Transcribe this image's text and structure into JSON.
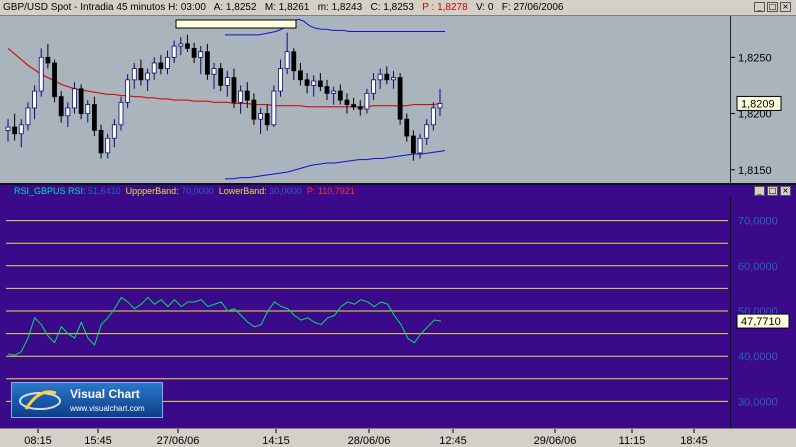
{
  "header": {
    "title": "GBP/USD Spot - Intradia 45 minutos",
    "h_label": "H:",
    "h_value": "03:00",
    "a_label": "A:",
    "a_value": "1,8252",
    "m_upper_label": "M:",
    "m_upper_value": "1,8261",
    "m_lower_label": "m:",
    "m_lower_value": "1,8243",
    "c_label": "C:",
    "c_value": "1,8253",
    "p_label": "P :",
    "p_value": "1,8278",
    "v_label": "V:",
    "v_value": "0",
    "f_label": "F:",
    "f_value": "27/06/2006"
  },
  "window_buttons": [
    "_",
    "□",
    "×"
  ],
  "rsi_header": {
    "rsi_label": "RSI_GBPUS RSI:",
    "rsi_value": "51,6410",
    "upper_label": "UppperBand:",
    "upper_value": "70,0000",
    "lower_label": "LowerBand:",
    "lower_value": "30,0000",
    "p_label": "P:",
    "p_value": "110,7921"
  },
  "logo": {
    "title": "Visual Chart",
    "url": "www.visualchart.com"
  },
  "colors": {
    "price_bg": "#a9b4bd",
    "candle_up": "#0a0a7a",
    "candle_down": "#000000",
    "moving_average": "#d01010",
    "bollinger": "#1010d0",
    "rsi_bg": "#3a0a8a",
    "rsi_line": "#00e070",
    "rsi_levels": "#e8e040"
  },
  "chart_data": [
    {
      "type": "candlestick",
      "title": "GBP/USD Spot - Intradia 45 minutos",
      "ylim": [
        1.814,
        1.8285
      ],
      "y_ticks": [
        "1,8250",
        "1,8200",
        "1,8150"
      ],
      "y_tick_values": [
        1.825,
        1.82,
        1.815
      ],
      "last_value_label": "1,8209",
      "last_value": 1.8209,
      "candles": [
        {
          "o": 1.8185,
          "h": 1.8195,
          "l": 1.8175,
          "c": 1.8188
        },
        {
          "o": 1.8188,
          "h": 1.82,
          "l": 1.8176,
          "c": 1.8182
        },
        {
          "o": 1.8182,
          "h": 1.8195,
          "l": 1.817,
          "c": 1.819
        },
        {
          "o": 1.819,
          "h": 1.821,
          "l": 1.8185,
          "c": 1.8205
        },
        {
          "o": 1.8205,
          "h": 1.8225,
          "l": 1.8195,
          "c": 1.822
        },
        {
          "o": 1.822,
          "h": 1.8258,
          "l": 1.8215,
          "c": 1.825
        },
        {
          "o": 1.825,
          "h": 1.8262,
          "l": 1.824,
          "c": 1.8245
        },
        {
          "o": 1.8245,
          "h": 1.8248,
          "l": 1.821,
          "c": 1.8215
        },
        {
          "o": 1.8215,
          "h": 1.822,
          "l": 1.8192,
          "c": 1.8198
        },
        {
          "o": 1.8198,
          "h": 1.821,
          "l": 1.8188,
          "c": 1.8205
        },
        {
          "o": 1.8205,
          "h": 1.8228,
          "l": 1.82,
          "c": 1.8222
        },
        {
          "o": 1.8222,
          "h": 1.8226,
          "l": 1.8195,
          "c": 1.82
        },
        {
          "o": 1.82,
          "h": 1.8212,
          "l": 1.8192,
          "c": 1.8208
        },
        {
          "o": 1.8208,
          "h": 1.8215,
          "l": 1.818,
          "c": 1.8185
        },
        {
          "o": 1.8185,
          "h": 1.819,
          "l": 1.816,
          "c": 1.8165
        },
        {
          "o": 1.8165,
          "h": 1.8182,
          "l": 1.816,
          "c": 1.8178
        },
        {
          "o": 1.8178,
          "h": 1.8195,
          "l": 1.817,
          "c": 1.819
        },
        {
          "o": 1.819,
          "h": 1.8215,
          "l": 1.8185,
          "c": 1.821
        },
        {
          "o": 1.821,
          "h": 1.8235,
          "l": 1.8205,
          "c": 1.823
        },
        {
          "o": 1.823,
          "h": 1.8245,
          "l": 1.8222,
          "c": 1.824
        },
        {
          "o": 1.824,
          "h": 1.8248,
          "l": 1.8225,
          "c": 1.823
        },
        {
          "o": 1.823,
          "h": 1.824,
          "l": 1.822,
          "c": 1.8236
        },
        {
          "o": 1.8236,
          "h": 1.825,
          "l": 1.823,
          "c": 1.8245
        },
        {
          "o": 1.8245,
          "h": 1.8252,
          "l": 1.8235,
          "c": 1.824
        },
        {
          "o": 1.824,
          "h": 1.8256,
          "l": 1.8235,
          "c": 1.825
        },
        {
          "o": 1.825,
          "h": 1.8265,
          "l": 1.8245,
          "c": 1.826
        },
        {
          "o": 1.826,
          "h": 1.8268,
          "l": 1.8252,
          "c": 1.8262
        },
        {
          "o": 1.8262,
          "h": 1.827,
          "l": 1.8255,
          "c": 1.8258
        },
        {
          "o": 1.8258,
          "h": 1.8263,
          "l": 1.8245,
          "c": 1.825
        },
        {
          "o": 1.825,
          "h": 1.826,
          "l": 1.8235,
          "c": 1.8255
        },
        {
          "o": 1.8255,
          "h": 1.8262,
          "l": 1.823,
          "c": 1.8235
        },
        {
          "o": 1.8235,
          "h": 1.8245,
          "l": 1.8222,
          "c": 1.824
        },
        {
          "o": 1.824,
          "h": 1.8245,
          "l": 1.822,
          "c": 1.8225
        },
        {
          "o": 1.8225,
          "h": 1.8238,
          "l": 1.8215,
          "c": 1.8232
        },
        {
          "o": 1.8232,
          "h": 1.824,
          "l": 1.8205,
          "c": 1.821
        },
        {
          "o": 1.821,
          "h": 1.8225,
          "l": 1.82,
          "c": 1.822
        },
        {
          "o": 1.822,
          "h": 1.8228,
          "l": 1.8205,
          "c": 1.8212
        },
        {
          "o": 1.8212,
          "h": 1.8218,
          "l": 1.819,
          "c": 1.8195
        },
        {
          "o": 1.8195,
          "h": 1.8205,
          "l": 1.8182,
          "c": 1.82
        },
        {
          "o": 1.82,
          "h": 1.8208,
          "l": 1.8185,
          "c": 1.819
        },
        {
          "o": 1.819,
          "h": 1.8225,
          "l": 1.8188,
          "c": 1.822
        },
        {
          "o": 1.822,
          "h": 1.8248,
          "l": 1.8215,
          "c": 1.824
        },
        {
          "o": 1.824,
          "h": 1.8272,
          "l": 1.8235,
          "c": 1.8255
        },
        {
          "o": 1.8255,
          "h": 1.8258,
          "l": 1.823,
          "c": 1.8238
        },
        {
          "o": 1.8238,
          "h": 1.8245,
          "l": 1.8225,
          "c": 1.823
        },
        {
          "o": 1.823,
          "h": 1.8236,
          "l": 1.8218,
          "c": 1.8225
        },
        {
          "o": 1.8225,
          "h": 1.8234,
          "l": 1.8215,
          "c": 1.8229
        },
        {
          "o": 1.8229,
          "h": 1.8236,
          "l": 1.822,
          "c": 1.8224
        },
        {
          "o": 1.8224,
          "h": 1.823,
          "l": 1.8212,
          "c": 1.8218
        },
        {
          "o": 1.8218,
          "h": 1.8224,
          "l": 1.8208,
          "c": 1.822
        },
        {
          "o": 1.822,
          "h": 1.8226,
          "l": 1.8208,
          "c": 1.8212
        },
        {
          "o": 1.8212,
          "h": 1.8218,
          "l": 1.82,
          "c": 1.8208
        },
        {
          "o": 1.8208,
          "h": 1.8214,
          "l": 1.8203,
          "c": 1.8206
        },
        {
          "o": 1.8206,
          "h": 1.8212,
          "l": 1.8198,
          "c": 1.8204
        },
        {
          "o": 1.8204,
          "h": 1.8222,
          "l": 1.82,
          "c": 1.8218
        },
        {
          "o": 1.8218,
          "h": 1.8236,
          "l": 1.8212,
          "c": 1.823
        },
        {
          "o": 1.823,
          "h": 1.824,
          "l": 1.8222,
          "c": 1.8235
        },
        {
          "o": 1.8235,
          "h": 1.8242,
          "l": 1.8226,
          "c": 1.823
        },
        {
          "o": 1.823,
          "h": 1.8238,
          "l": 1.8222,
          "c": 1.8232
        },
        {
          "o": 1.8232,
          "h": 1.8236,
          "l": 1.819,
          "c": 1.8195
        },
        {
          "o": 1.8195,
          "h": 1.82,
          "l": 1.8175,
          "c": 1.818
        },
        {
          "o": 1.818,
          "h": 1.8185,
          "l": 1.8158,
          "c": 1.8165
        },
        {
          "o": 1.8165,
          "h": 1.8182,
          "l": 1.816,
          "c": 1.8178
        },
        {
          "o": 1.8178,
          "h": 1.8195,
          "l": 1.8172,
          "c": 1.819
        },
        {
          "o": 1.819,
          "h": 1.821,
          "l": 1.8185,
          "c": 1.8205
        },
        {
          "o": 1.8205,
          "h": 1.8222,
          "l": 1.8198,
          "c": 1.8209
        }
      ],
      "moving_average": [
        1.8258,
        1.8253,
        1.8248,
        1.8243,
        1.8239,
        1.8235,
        1.8232,
        1.8229,
        1.8226,
        1.8224,
        1.8222,
        1.8221,
        1.822,
        1.8219,
        1.8218,
        1.8217,
        1.8217,
        1.8216,
        1.8216,
        1.8215,
        1.8215,
        1.8214,
        1.8214,
        1.8213,
        1.8213,
        1.8212,
        1.8212,
        1.8212,
        1.8211,
        1.8211,
        1.8211,
        1.821,
        1.821,
        1.821,
        1.8209,
        1.8209,
        1.8209,
        1.8208,
        1.8208,
        1.8208,
        1.8207,
        1.8207,
        1.8207,
        1.8207,
        1.8207,
        1.8206,
        1.8206,
        1.8206,
        1.8206,
        1.8206,
        1.8206,
        1.8206,
        1.8206,
        1.8206,
        1.8206,
        1.8207,
        1.8207,
        1.8207,
        1.8207,
        1.8207,
        1.8207,
        1.8208,
        1.8208,
        1.8208,
        1.8208,
        1.8209
      ],
      "bollinger_upper": [
        1.827,
        1.827,
        1.827,
        1.827,
        1.827,
        1.827,
        1.827,
        1.8271,
        1.8272,
        1.8273,
        1.8275,
        1.8278,
        1.8282,
        1.8284,
        1.8282,
        1.8278,
        1.8276,
        1.8275,
        1.8275,
        1.8274,
        1.8274,
        1.8274,
        1.8273,
        1.8273,
        1.8273,
        1.8273,
        1.8273,
        1.8273,
        1.8273,
        1.8273,
        1.8273,
        1.8273,
        1.8273,
        1.8273,
        1.8273,
        1.8273,
        1.8273,
        1.8273,
        1.8273,
        1.8273
      ],
      "bollinger_lower": [
        1.8142,
        1.8142,
        1.8143,
        1.8143,
        1.8144,
        1.8145,
        1.8146,
        1.8147,
        1.8148,
        1.815,
        1.8152,
        1.8154,
        1.8155,
        1.8156,
        1.8156,
        1.8157,
        1.8158,
        1.8159,
        1.8159,
        1.816,
        1.816,
        1.8161,
        1.8162,
        1.8163,
        1.8164,
        1.8164,
        1.8165,
        1.8166,
        1.8167
      ],
      "highlight_box_label": ""
    },
    {
      "type": "line",
      "title": "RSI_GBPUS RSI",
      "ylim": [
        25,
        75
      ],
      "y_ticks": [
        "70,0000",
        "60,0000",
        "50,0000",
        "40,0000",
        "30,0000"
      ],
      "y_tick_values": [
        70,
        60,
        50,
        40,
        30
      ],
      "levels": [
        70,
        65,
        60,
        55,
        50,
        45,
        40,
        35,
        30
      ],
      "last_value_label": "47,7710",
      "last_value": 47.771,
      "values": [
        40.5,
        40.2,
        41.0,
        44.0,
        48.5,
        47.0,
        44.5,
        43.0,
        46.5,
        45.0,
        44.0,
        47.5,
        44.0,
        42.5,
        47.0,
        48.5,
        50.5,
        53.0,
        52.0,
        50.5,
        51.5,
        53.0,
        51.5,
        52.5,
        51.0,
        52.5,
        51.0,
        52.0,
        52.0,
        52.5,
        51.0,
        51.5,
        52.0,
        50.0,
        50.5,
        49.0,
        47.5,
        46.5,
        47.0,
        50.0,
        52.0,
        51.0,
        50.5,
        49.0,
        48.0,
        48.5,
        47.5,
        47.0,
        48.5,
        49.0,
        51.0,
        52.0,
        51.5,
        52.5,
        52.0,
        51.0,
        52.0,
        51.5,
        49.0,
        47.0,
        44.0,
        43.0,
        45.0,
        46.5,
        48.0,
        47.771
      ]
    }
  ],
  "time_axis": {
    "labels": [
      "08:15",
      "15:45",
      "27/06/06",
      "14:15",
      "28/06/06",
      "12:45",
      "29/06/06",
      "11:15",
      "18:45"
    ]
  }
}
